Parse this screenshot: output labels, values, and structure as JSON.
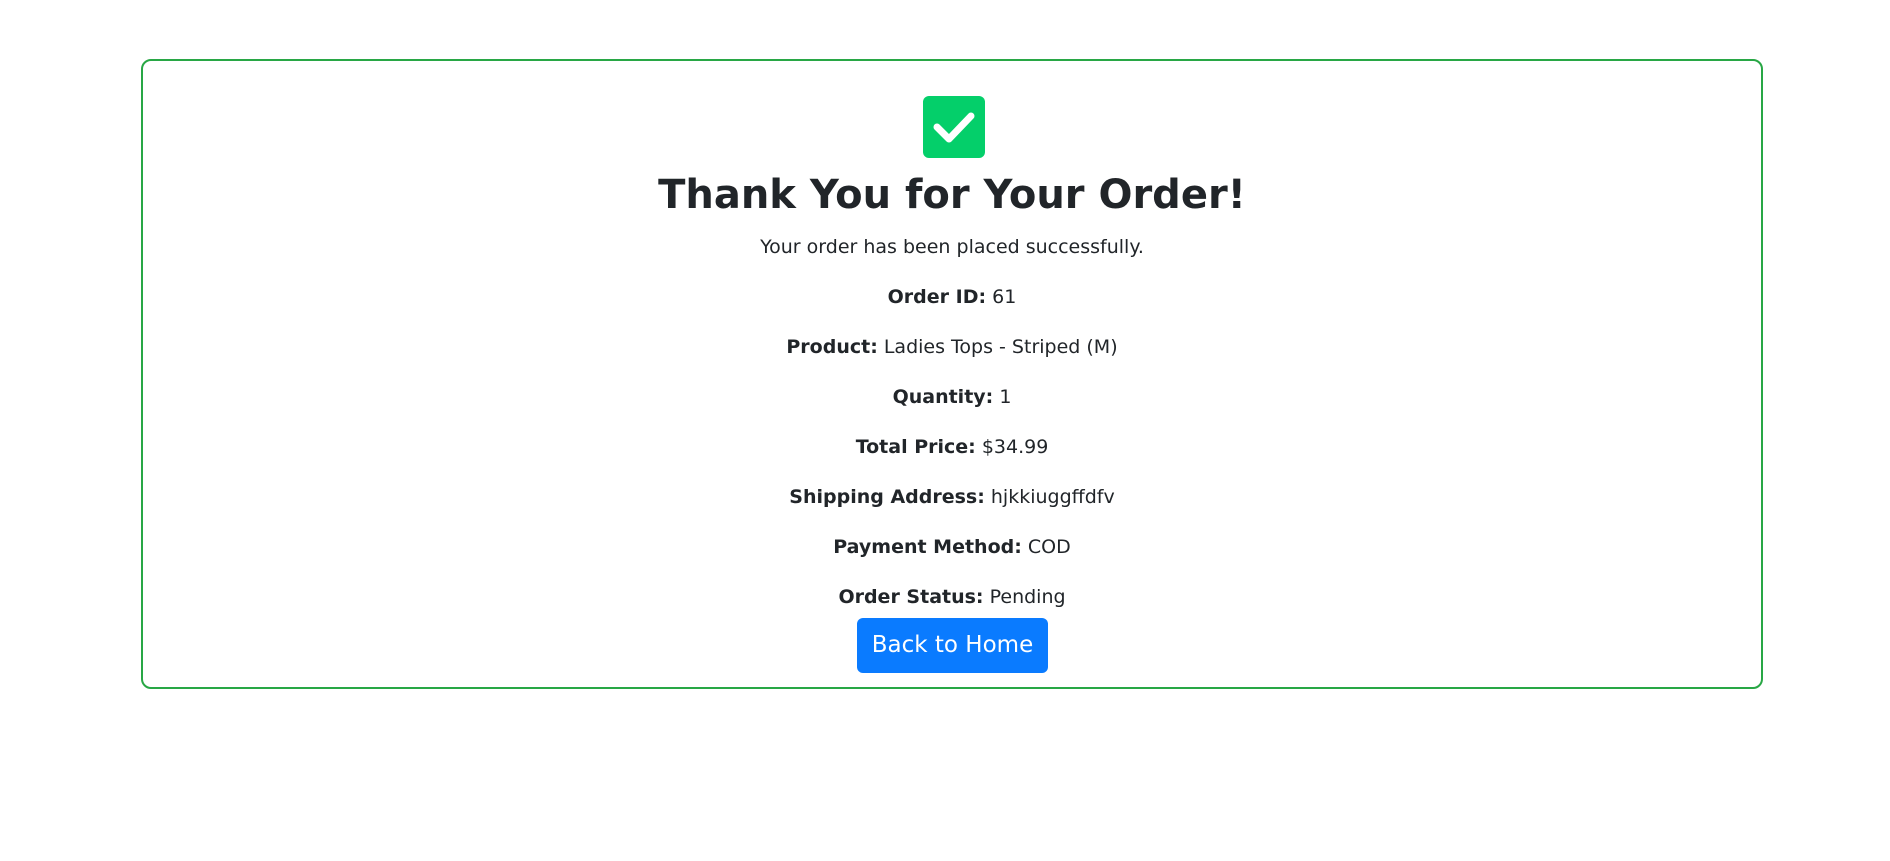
{
  "confirmation": {
    "icon": "check-square-icon",
    "accent_color": "#28a745",
    "icon_color": "#04cf6a",
    "title": "Thank You for Your Order!",
    "subtitle": "Your order has been placed successfully.",
    "details": [
      {
        "label": "Order ID:",
        "value": "61"
      },
      {
        "label": "Product:",
        "value": "Ladies Tops - Striped (M)"
      },
      {
        "label": "Quantity:",
        "value": "1"
      },
      {
        "label": "Total Price:",
        "value": "$34.99"
      },
      {
        "label": "Shipping Address:",
        "value": "hjkkiuggffdfv"
      },
      {
        "label": "Payment Method:",
        "value": "COD"
      },
      {
        "label": "Order Status:",
        "value": "Pending"
      }
    ],
    "button_label": "Back to Home",
    "button_color": "#0a7bff"
  }
}
